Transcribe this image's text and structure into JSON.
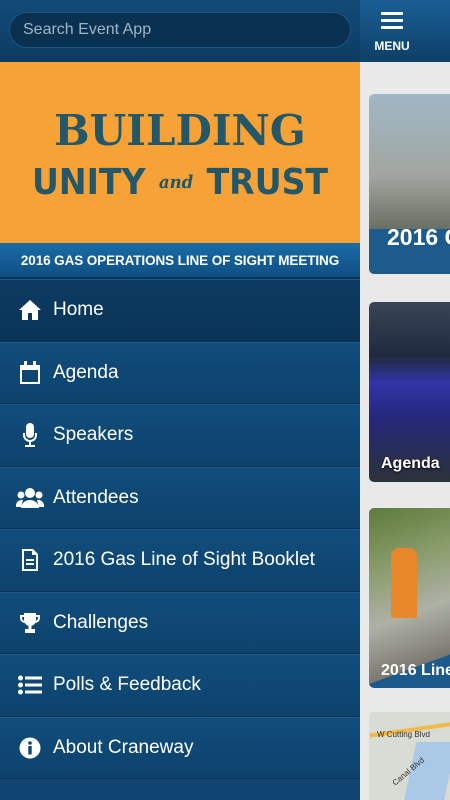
{
  "search": {
    "placeholder": "Search Event App"
  },
  "banner": {
    "line1": "BUILDING",
    "line2_left": "UNITY",
    "line2_mid": "and",
    "line2_right": "TRUST",
    "subtitle": "2016 GAS OPERATIONS LINE OF SIGHT MEETING"
  },
  "nav": [
    {
      "label": "Home",
      "icon": "home-icon"
    },
    {
      "label": "Agenda",
      "icon": "calendar-icon"
    },
    {
      "label": "Speakers",
      "icon": "microphone-icon"
    },
    {
      "label": "Attendees",
      "icon": "people-icon"
    },
    {
      "label": "2016 Gas Line of Sight Booklet",
      "icon": "document-icon"
    },
    {
      "label": "Challenges",
      "icon": "trophy-icon"
    },
    {
      "label": "Polls & Feedback",
      "icon": "list-icon"
    },
    {
      "label": "About Craneway",
      "icon": "info-icon"
    }
  ],
  "topbar": {
    "menu_label": "MENU"
  },
  "cards": [
    {
      "label": "2016 G"
    },
    {
      "label": "Agenda"
    },
    {
      "label": "2016 Line"
    },
    {
      "map_label_1": "W Cutting Blvd",
      "map_label_2": "Canal Blvd"
    }
  ],
  "colors": {
    "accent": "#f6a237",
    "nav_bg": "#0f4570",
    "banner_text": "#245869"
  }
}
